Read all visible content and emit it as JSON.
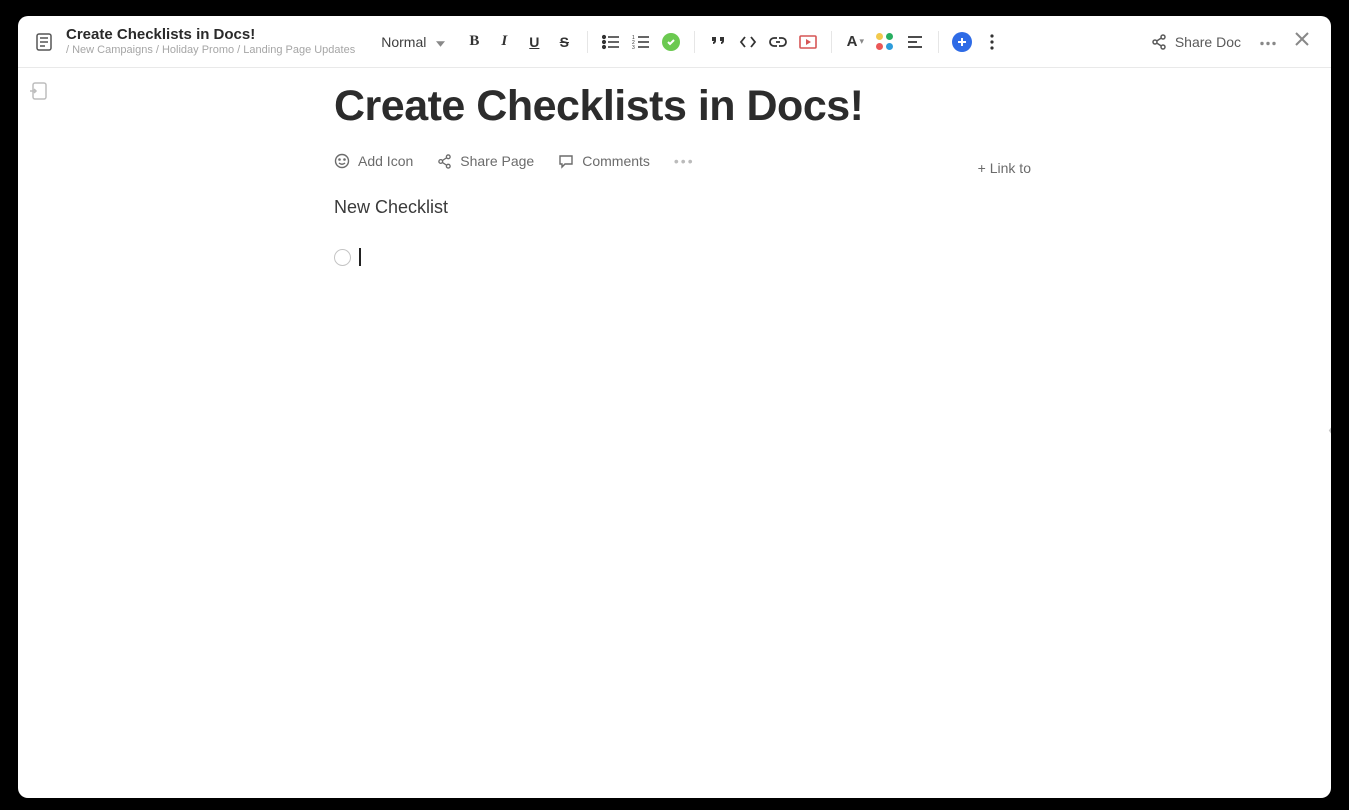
{
  "header": {
    "title": "Create Checklists in Docs!",
    "breadcrumb": "/ New Campaigns / Holiday Promo / Landing Page Updates"
  },
  "toolbar": {
    "styleSelect": "Normal",
    "bold": "B",
    "italic": "I",
    "underline": "U",
    "strike": "S",
    "fontLetter": "A"
  },
  "share": {
    "label": "Share Doc"
  },
  "page": {
    "heading": "Create Checklists in Docs!",
    "actions": {
      "addIcon": "Add Icon",
      "sharePage": "Share Page",
      "comments": "Comments",
      "linkTo": "+ Link to"
    },
    "subheading": "New Checklist"
  },
  "colors": {
    "grid": [
      "#f2c94c",
      "#27ae60",
      "#eb5757",
      "#2d9cdb"
    ]
  }
}
